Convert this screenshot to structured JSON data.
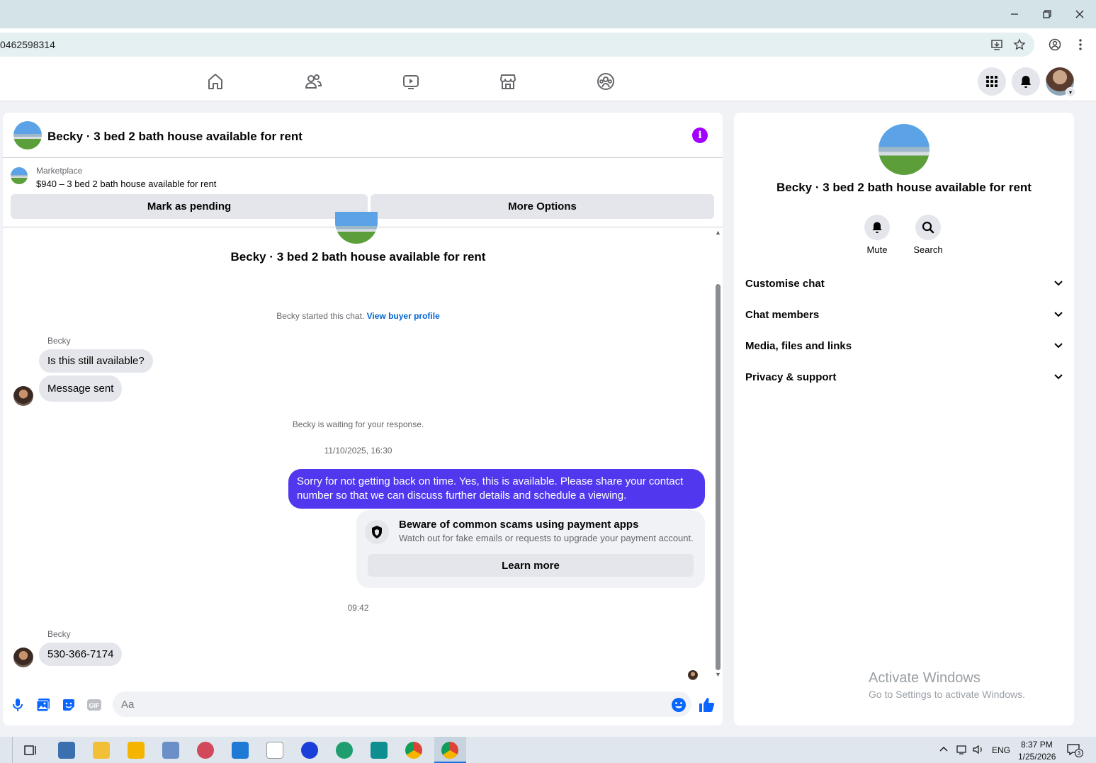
{
  "browser": {
    "url_fragment": "0462598314"
  },
  "chat": {
    "title": "Becky · 3 bed 2 bath house available for rent",
    "listing": {
      "label": "Marketplace",
      "title": "$940 – 3 bed 2 bath house available for rent"
    },
    "buttons": {
      "mark_pending": "Mark as pending",
      "more_options": "More Options"
    },
    "thread_title": "Becky · 3 bed 2 bath house available for rent",
    "started_text": "Becky started this chat.",
    "view_buyer_profile": "View buyer profile",
    "messages": [
      {
        "sender": "Becky",
        "text": "Is this still available?"
      },
      {
        "text": "Message sent"
      }
    ],
    "waiting_text": "Becky is waiting for your response.",
    "timestamp1": "11/10/2025, 16:30",
    "outgoing": "Sorry for not getting back on time. Yes, this is available. Please share your contact number so that we can discuss further details and schedule a viewing.",
    "scam_card": {
      "title": "Beware of common scams using payment apps",
      "subtitle": "Watch out for fake emails or requests to upgrade your payment account.",
      "button": "Learn more"
    },
    "timestamp2": "09:42",
    "reply": {
      "sender": "Becky",
      "text": "530-366-7174"
    },
    "composer_placeholder": "Aa"
  },
  "right_panel": {
    "title": "Becky · 3 bed 2 bath house available for rent",
    "actions": [
      {
        "label": "Mute"
      },
      {
        "label": "Search"
      }
    ],
    "sections": [
      "Customise chat",
      "Chat members",
      "Media, files and links",
      "Privacy & support"
    ],
    "watermark_title": "Activate Windows",
    "watermark_sub": "Go to Settings to activate Windows."
  },
  "taskbar": {
    "lang": "ENG",
    "time": "8:37 PM",
    "date": "1/25/2026",
    "notif_count": "3"
  },
  "colors": {
    "accent_purple": "#a100ff",
    "outgoing_bubble": "#5138ee",
    "link": "#0064d1",
    "like": "#0866ff"
  }
}
